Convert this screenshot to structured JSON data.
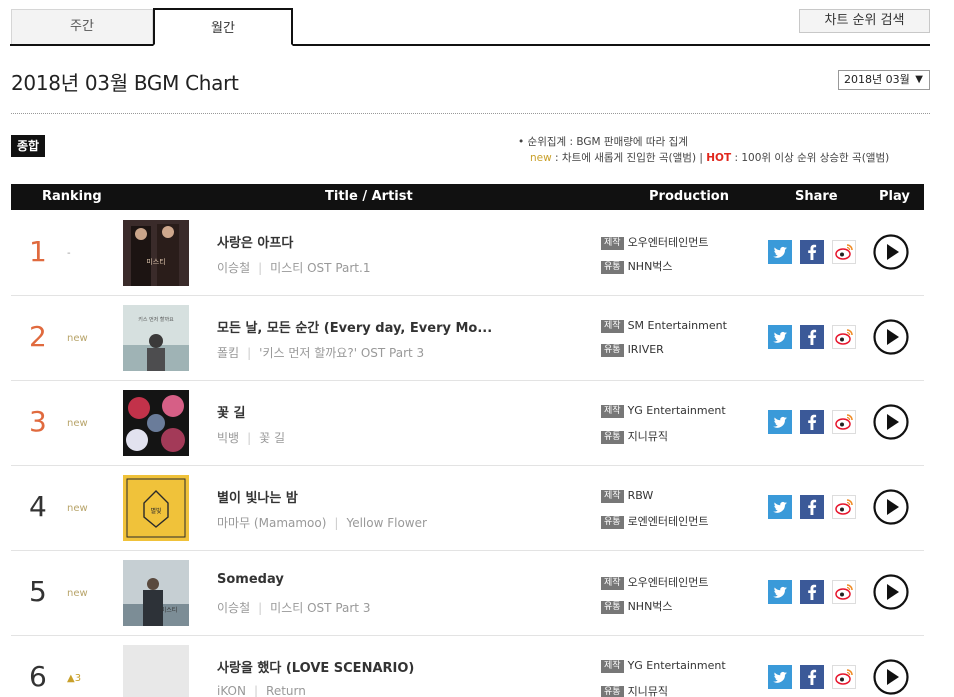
{
  "tabs": {
    "weekly": "주간",
    "monthly": "월간"
  },
  "search_button": "차트 순위 검색",
  "page_title": "2018년 03월 BGM Chart",
  "month_select": {
    "value": "2018년 03월",
    "arrow": "▼"
  },
  "badge": "종합",
  "notes": {
    "line1": "• 순위집계 : BGM 판매량에 따라 집계",
    "new_label": "new",
    "line2_a": " : 차트에 새롭게 진입한 곡(앨범)  |  ",
    "hot_label": "HOT",
    "line2_b": " : 100위 이상 순위 상승한 곡(앨범)"
  },
  "columns": {
    "ranking": "Ranking",
    "title_artist": "Title / Artist",
    "production": "Production",
    "share": "Share",
    "play": "Play"
  },
  "production_tags": {
    "make": "제작",
    "distribute": "유통"
  },
  "colors": {
    "rank_accent": "#e06a3e",
    "header_bg": "#111111",
    "new_text": "#c9a02a",
    "hot_text": "#e0271c"
  },
  "rows": [
    {
      "rank": "1",
      "change": "-",
      "title": "사랑은 아프다",
      "artist": "이승철",
      "album": "미스티 OST Part.1",
      "maker": "오우엔터테인먼트",
      "distributor": "NHN벅스"
    },
    {
      "rank": "2",
      "change": "new",
      "title": "모든 날, 모든 순간 (Every day, Every Mo...",
      "artist": "폴킴",
      "album": "'키스 먼저 할까요?' OST Part 3",
      "maker": "SM Entertainment",
      "distributor": "IRIVER"
    },
    {
      "rank": "3",
      "change": "new",
      "title": "꽃 길",
      "artist": "빅뱅",
      "album": "꽃 길",
      "maker": "YG Entertainment",
      "distributor": "지니뮤직"
    },
    {
      "rank": "4",
      "change": "new",
      "title": "별이 빛나는 밤",
      "artist": "마마무 (Mamamoo)",
      "album": "Yellow Flower",
      "maker": "RBW",
      "distributor": "로엔엔터테인먼트"
    },
    {
      "rank": "5",
      "change": "new",
      "title": "Someday",
      "artist": "이승철",
      "album": "미스티 OST Part 3",
      "maker": "오우엔터테인먼트",
      "distributor": "NHN벅스"
    },
    {
      "rank": "6",
      "change": "▲3",
      "title": "사랑을 했다 (LOVE SCENARIO)",
      "artist": "iKON",
      "album": "Return",
      "maker": "YG Entertainment",
      "distributor": "지니뮤직"
    }
  ]
}
